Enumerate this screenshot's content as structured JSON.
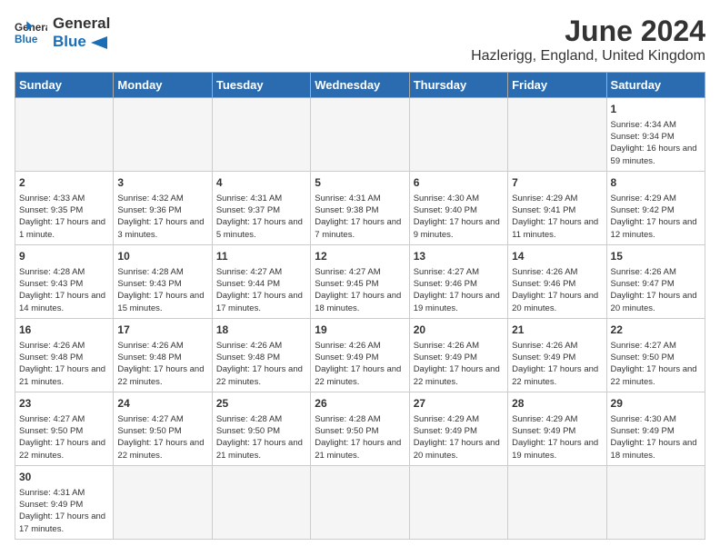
{
  "header": {
    "logo_general": "General",
    "logo_blue": "Blue",
    "title": "June 2024",
    "subtitle": "Hazlerigg, England, United Kingdom"
  },
  "days_of_week": [
    "Sunday",
    "Monday",
    "Tuesday",
    "Wednesday",
    "Thursday",
    "Friday",
    "Saturday"
  ],
  "weeks": [
    [
      {
        "day": "",
        "info": ""
      },
      {
        "day": "",
        "info": ""
      },
      {
        "day": "",
        "info": ""
      },
      {
        "day": "",
        "info": ""
      },
      {
        "day": "",
        "info": ""
      },
      {
        "day": "",
        "info": ""
      },
      {
        "day": "1",
        "info": "Sunrise: 4:34 AM\nSunset: 9:34 PM\nDaylight: 16 hours and 59 minutes."
      }
    ],
    [
      {
        "day": "2",
        "info": "Sunrise: 4:33 AM\nSunset: 9:35 PM\nDaylight: 17 hours and 1 minute."
      },
      {
        "day": "3",
        "info": "Sunrise: 4:32 AM\nSunset: 9:36 PM\nDaylight: 17 hours and 3 minutes."
      },
      {
        "day": "4",
        "info": "Sunrise: 4:31 AM\nSunset: 9:37 PM\nDaylight: 17 hours and 5 minutes."
      },
      {
        "day": "5",
        "info": "Sunrise: 4:31 AM\nSunset: 9:38 PM\nDaylight: 17 hours and 7 minutes."
      },
      {
        "day": "6",
        "info": "Sunrise: 4:30 AM\nSunset: 9:40 PM\nDaylight: 17 hours and 9 minutes."
      },
      {
        "day": "7",
        "info": "Sunrise: 4:29 AM\nSunset: 9:41 PM\nDaylight: 17 hours and 11 minutes."
      },
      {
        "day": "8",
        "info": "Sunrise: 4:29 AM\nSunset: 9:42 PM\nDaylight: 17 hours and 12 minutes."
      }
    ],
    [
      {
        "day": "9",
        "info": "Sunrise: 4:28 AM\nSunset: 9:43 PM\nDaylight: 17 hours and 14 minutes."
      },
      {
        "day": "10",
        "info": "Sunrise: 4:28 AM\nSunset: 9:43 PM\nDaylight: 17 hours and 15 minutes."
      },
      {
        "day": "11",
        "info": "Sunrise: 4:27 AM\nSunset: 9:44 PM\nDaylight: 17 hours and 17 minutes."
      },
      {
        "day": "12",
        "info": "Sunrise: 4:27 AM\nSunset: 9:45 PM\nDaylight: 17 hours and 18 minutes."
      },
      {
        "day": "13",
        "info": "Sunrise: 4:27 AM\nSunset: 9:46 PM\nDaylight: 17 hours and 19 minutes."
      },
      {
        "day": "14",
        "info": "Sunrise: 4:26 AM\nSunset: 9:46 PM\nDaylight: 17 hours and 20 minutes."
      },
      {
        "day": "15",
        "info": "Sunrise: 4:26 AM\nSunset: 9:47 PM\nDaylight: 17 hours and 20 minutes."
      }
    ],
    [
      {
        "day": "16",
        "info": "Sunrise: 4:26 AM\nSunset: 9:48 PM\nDaylight: 17 hours and 21 minutes."
      },
      {
        "day": "17",
        "info": "Sunrise: 4:26 AM\nSunset: 9:48 PM\nDaylight: 17 hours and 22 minutes."
      },
      {
        "day": "18",
        "info": "Sunrise: 4:26 AM\nSunset: 9:48 PM\nDaylight: 17 hours and 22 minutes."
      },
      {
        "day": "19",
        "info": "Sunrise: 4:26 AM\nSunset: 9:49 PM\nDaylight: 17 hours and 22 minutes."
      },
      {
        "day": "20",
        "info": "Sunrise: 4:26 AM\nSunset: 9:49 PM\nDaylight: 17 hours and 22 minutes."
      },
      {
        "day": "21",
        "info": "Sunrise: 4:26 AM\nSunset: 9:49 PM\nDaylight: 17 hours and 22 minutes."
      },
      {
        "day": "22",
        "info": "Sunrise: 4:27 AM\nSunset: 9:50 PM\nDaylight: 17 hours and 22 minutes."
      }
    ],
    [
      {
        "day": "23",
        "info": "Sunrise: 4:27 AM\nSunset: 9:50 PM\nDaylight: 17 hours and 22 minutes."
      },
      {
        "day": "24",
        "info": "Sunrise: 4:27 AM\nSunset: 9:50 PM\nDaylight: 17 hours and 22 minutes."
      },
      {
        "day": "25",
        "info": "Sunrise: 4:28 AM\nSunset: 9:50 PM\nDaylight: 17 hours and 21 minutes."
      },
      {
        "day": "26",
        "info": "Sunrise: 4:28 AM\nSunset: 9:50 PM\nDaylight: 17 hours and 21 minutes."
      },
      {
        "day": "27",
        "info": "Sunrise: 4:29 AM\nSunset: 9:49 PM\nDaylight: 17 hours and 20 minutes."
      },
      {
        "day": "28",
        "info": "Sunrise: 4:29 AM\nSunset: 9:49 PM\nDaylight: 17 hours and 19 minutes."
      },
      {
        "day": "29",
        "info": "Sunrise: 4:30 AM\nSunset: 9:49 PM\nDaylight: 17 hours and 18 minutes."
      }
    ],
    [
      {
        "day": "30",
        "info": "Sunrise: 4:31 AM\nSunset: 9:49 PM\nDaylight: 17 hours and 17 minutes."
      },
      {
        "day": "",
        "info": ""
      },
      {
        "day": "",
        "info": ""
      },
      {
        "day": "",
        "info": ""
      },
      {
        "day": "",
        "info": ""
      },
      {
        "day": "",
        "info": ""
      },
      {
        "day": "",
        "info": ""
      }
    ]
  ]
}
